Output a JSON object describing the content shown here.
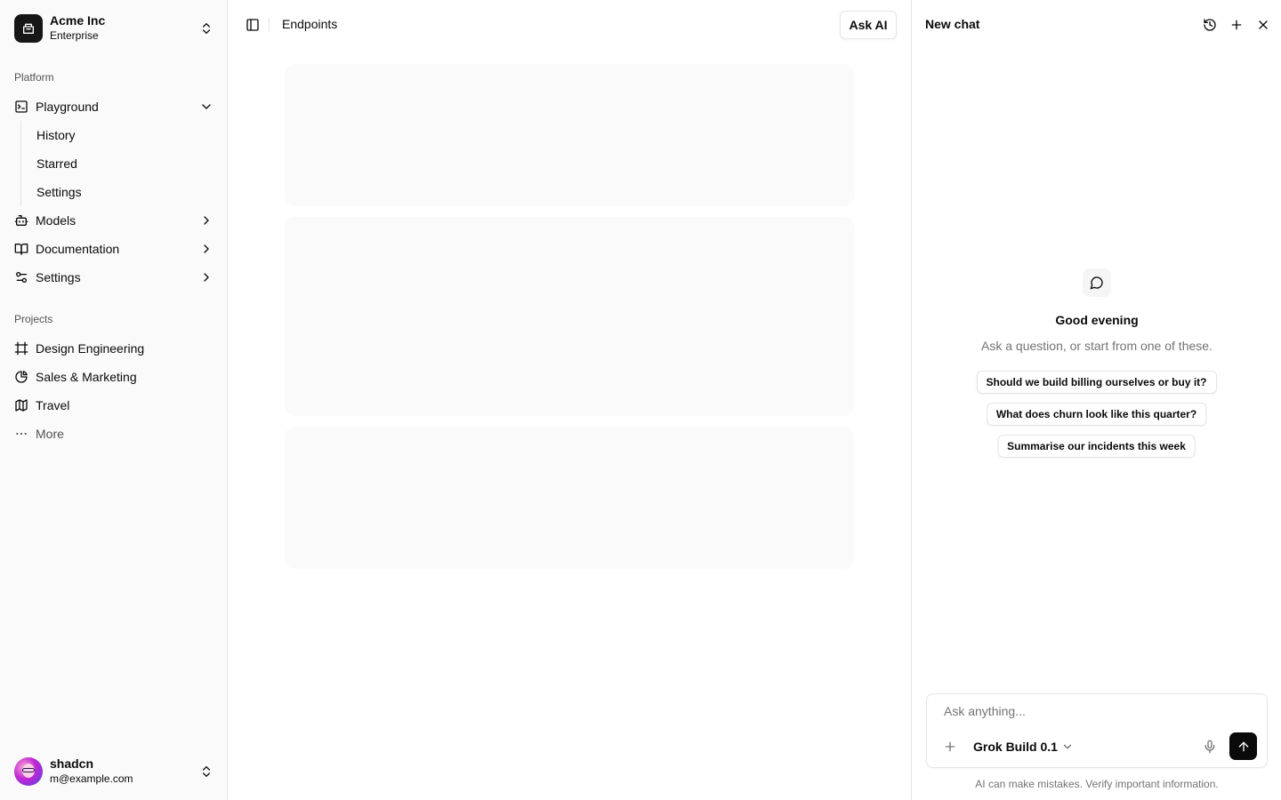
{
  "team": {
    "name": "Acme Inc",
    "plan": "Enterprise"
  },
  "sidebar": {
    "platform_label": "Platform",
    "nav": [
      {
        "label": "Playground",
        "icon": "terminal-square-icon",
        "expanded": true
      },
      {
        "label": "Models",
        "icon": "bot-icon"
      },
      {
        "label": "Documentation",
        "icon": "book-open-icon"
      },
      {
        "label": "Settings",
        "icon": "settings-sliders-icon"
      }
    ],
    "playground_sub": [
      {
        "label": "History"
      },
      {
        "label": "Starred"
      },
      {
        "label": "Settings"
      }
    ],
    "projects_label": "Projects",
    "projects": [
      {
        "label": "Design Engineering",
        "icon": "frame-icon"
      },
      {
        "label": "Sales & Marketing",
        "icon": "pie-chart-icon"
      },
      {
        "label": "Travel",
        "icon": "map-icon"
      }
    ],
    "more_label": "More"
  },
  "user": {
    "name": "shadcn",
    "email": "m@example.com"
  },
  "header": {
    "breadcrumb": "Endpoints",
    "ask_ai_label": "Ask AI"
  },
  "chat": {
    "title": "New chat",
    "greeting": "Good evening",
    "subtext": "Ask a question, or start from one of these.",
    "suggestions": [
      "Should we build billing ourselves or buy it?",
      "What does churn look like this quarter?",
      "Summarise our incidents this week"
    ],
    "input_placeholder": "Ask anything...",
    "model": "Grok Build 0.1",
    "disclaimer": "AI can make mistakes. Verify important information."
  },
  "colors": {
    "sidebar_bg": "#fafafa",
    "border": "#e5e5e5",
    "skeleton": "#fafafa",
    "primary": "#0a0a0a",
    "muted_text": "#737373"
  }
}
